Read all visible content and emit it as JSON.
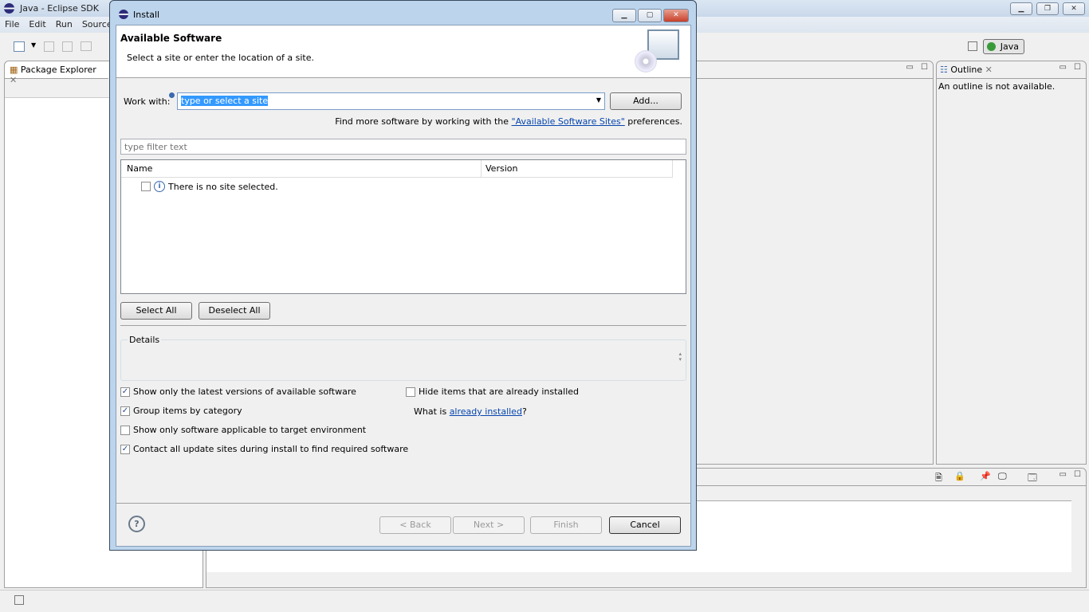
{
  "app": {
    "title": "Java - Eclipse SDK",
    "menu": [
      "File",
      "Edit",
      "Run",
      "Source"
    ],
    "perspective": "Java",
    "package_explorer": "Package Explorer",
    "outline": {
      "title": "Outline",
      "message": "An outline is not available."
    }
  },
  "dialog": {
    "title": "Install",
    "header_title": "Available Software",
    "header_desc": "Select a site or enter the location of a site.",
    "work_with_label": "Work with:",
    "work_with_value": "type or select a site",
    "add_label": "Add...",
    "find_more_prefix": "Find more software by working with the ",
    "find_more_link": "\"Available Software Sites\"",
    "find_more_suffix": " preferences.",
    "filter_placeholder": "type filter text",
    "columns": [
      "Name",
      "Version"
    ],
    "empty_message": "There is no site selected.",
    "select_all": "Select All",
    "deselect_all": "Deselect All",
    "details_label": "Details",
    "options": [
      {
        "label": "Show only the latest versions of available software",
        "checked": true
      },
      {
        "label": "Group items by category",
        "checked": true
      },
      {
        "label": "Show only software applicable to target environment",
        "checked": false
      },
      {
        "label": "Contact all update sites during install to find required software",
        "checked": true
      },
      {
        "label": "Hide items that are already installed",
        "checked": false
      }
    ],
    "what_is_prefix": "What is ",
    "what_is_link": "already installed",
    "what_is_suffix": "?",
    "back": "< Back",
    "next": "Next >",
    "finish": "Finish",
    "cancel": "Cancel"
  }
}
